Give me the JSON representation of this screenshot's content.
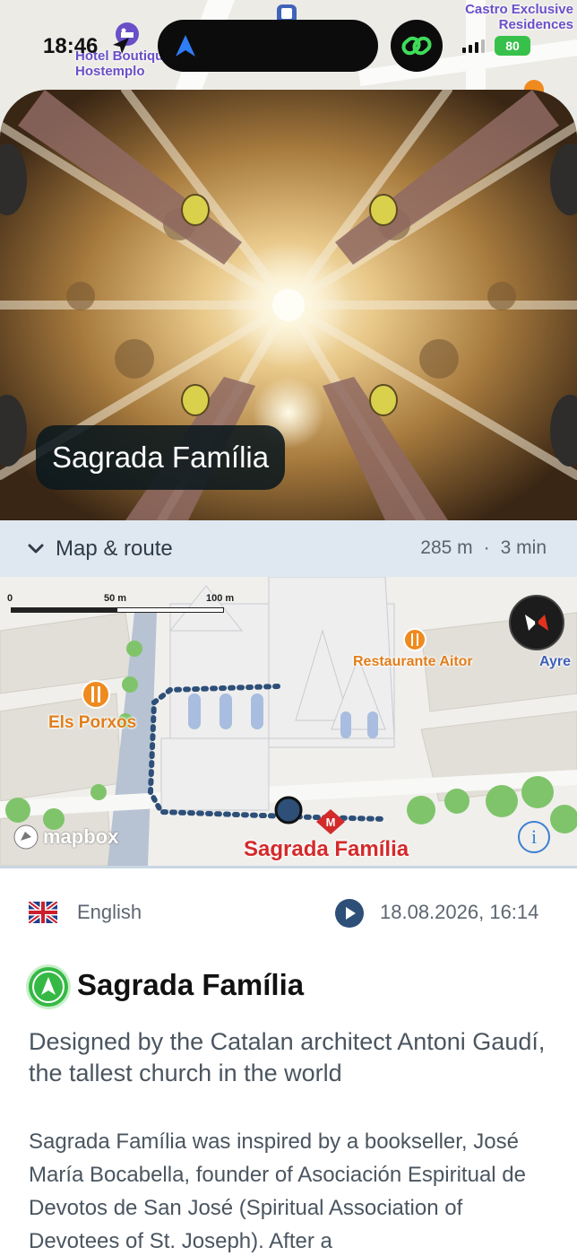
{
  "status_bar": {
    "time": "18:46",
    "battery": "80"
  },
  "background_map": {
    "labels": [
      {
        "text": "Hotel Boutique Hostemplo"
      },
      {
        "text": "Castro Exclusive Residences"
      }
    ]
  },
  "hero": {
    "title": "Sagrada Família"
  },
  "route": {
    "label": "Map & route",
    "distance": "285 m",
    "separator": "·",
    "duration": "3 min"
  },
  "map": {
    "scale": {
      "zero": "0",
      "mid": "50 m",
      "max": "100 m"
    },
    "labels": {
      "restaurant": "Restaurante Aitor",
      "porxos": "Els Porxos",
      "metro": "Sagrada Família",
      "edge": "Ayre"
    },
    "attribution": "mapbox",
    "colors": {
      "route": "#2d4f78",
      "poi": "#ef8a1f",
      "metro": "#d42a2a"
    }
  },
  "audio": {
    "language": "English",
    "datetime": "18.08.2026, 16:14"
  },
  "poi": {
    "title": "Sagrada Família",
    "subtitle": "Designed by the Catalan architect Antoni Gaudí, the tallest church in the world",
    "body": "Sagrada Família was inspired by a bookseller, José María Bocabella, founder of Asociación Espiritual de Devotos de San José (Spiritual Association of Devotees of St. Joseph). After a"
  },
  "icons": [
    "location-arrow-icon",
    "navigation-icon",
    "app-link-icon",
    "chevron-down-icon",
    "compass-icon",
    "mapbox-logo-icon",
    "info-icon",
    "uk-flag-icon",
    "play-icon",
    "navigation-badge-icon",
    "restaurant-icon",
    "metro-icon",
    "hotel-icon",
    "user-location-icon"
  ]
}
